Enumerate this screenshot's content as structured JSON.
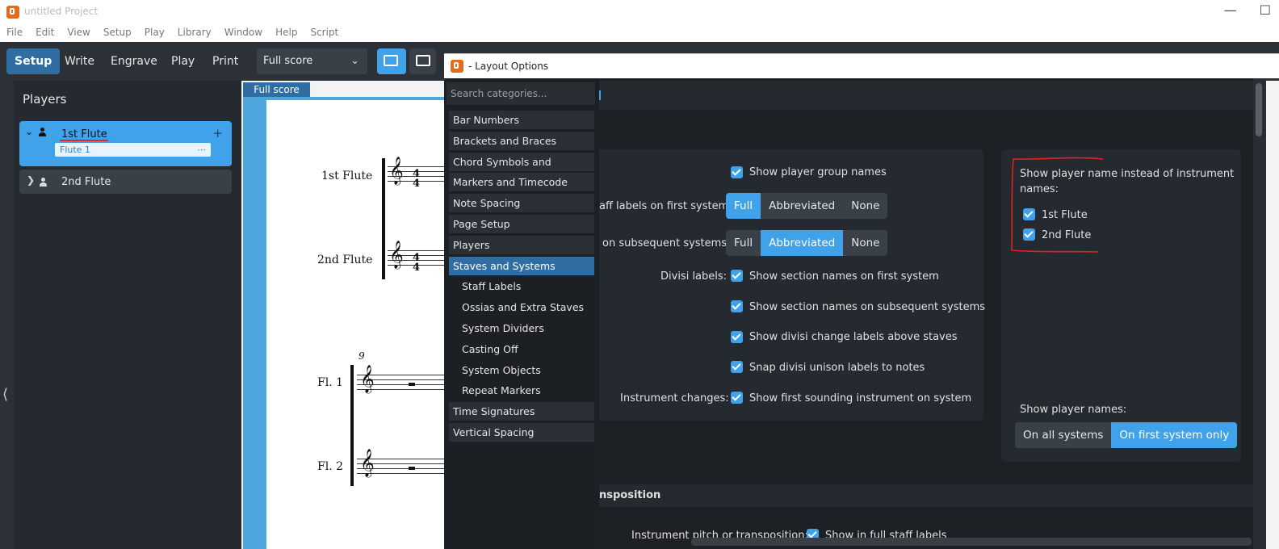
{
  "window": {
    "title": "untitled Project"
  },
  "menubar": [
    "File",
    "Edit",
    "View",
    "Setup",
    "Play",
    "Library",
    "Window",
    "Help",
    "Script"
  ],
  "toolbar": {
    "modes": [
      "Setup",
      "Write",
      "Engrave",
      "Play",
      "Print"
    ],
    "layout_select": "Full score"
  },
  "players_panel": {
    "title": "Players",
    "players": [
      {
        "name": "1st Flute",
        "instrument": "Flute 1",
        "expanded": true
      },
      {
        "name": "2nd Flute",
        "expanded": false
      }
    ]
  },
  "score": {
    "tab": "Full score",
    "labels_first": [
      "1st Flute",
      "2nd Flute"
    ],
    "labels_subsequent": [
      "Fl. 1",
      "Fl. 2"
    ],
    "bar_number": "9",
    "time_signature": "4/4"
  },
  "dialog": {
    "title": "- Layout Options",
    "search_placeholder": "Search categories...",
    "categories": [
      {
        "label": "Bar Numbers",
        "sub": false,
        "active": false
      },
      {
        "label": "Brackets and Braces",
        "sub": false,
        "active": false
      },
      {
        "label": "Chord Symbols and Diagrams",
        "sub": false,
        "active": false
      },
      {
        "label": "Markers and Timecode",
        "sub": false,
        "active": false
      },
      {
        "label": "Note Spacing",
        "sub": false,
        "active": false
      },
      {
        "label": "Page Setup",
        "sub": false,
        "active": false
      },
      {
        "label": "Players",
        "sub": false,
        "active": false
      },
      {
        "label": "Staves and Systems",
        "sub": false,
        "active": true
      },
      {
        "label": "Staff Labels",
        "sub": true,
        "active": false
      },
      {
        "label": "Ossias and Extra Staves",
        "sub": true,
        "active": false
      },
      {
        "label": "System Dividers",
        "sub": true,
        "active": false
      },
      {
        "label": "Casting Off",
        "sub": true,
        "active": false
      },
      {
        "label": "System Objects",
        "sub": true,
        "active": false
      },
      {
        "label": "Repeat Markers",
        "sub": true,
        "active": false
      },
      {
        "label": "Time Signatures",
        "sub": false,
        "active": false
      },
      {
        "label": "Vertical Spacing",
        "sub": false,
        "active": false
      }
    ],
    "options": {
      "show_player_group_names": "Show player group names",
      "staff_labels_first_label": "aff labels on first system:",
      "staff_labels_first": [
        "Full",
        "Abbreviated",
        "None"
      ],
      "staff_labels_first_selected": "Full",
      "staff_labels_subsequent_label": "on subsequent systems:",
      "staff_labels_subsequent": [
        "Full",
        "Abbreviated",
        "None"
      ],
      "staff_labels_subsequent_selected": "Abbreviated",
      "divisi_label": "Divisi labels:",
      "divisi_first": "Show section names on first system",
      "divisi_subsequent": "Show section names on subsequent systems",
      "divisi_change": "Show divisi change labels above staves",
      "divisi_snap": "Snap divisi unison labels to notes",
      "instrument_changes_label": "Instrument changes:",
      "instrument_changes": "Show first sounding instrument on system",
      "player_name_instead": "Show player name instead of instrument names:",
      "player_name_items": [
        "1st Flute",
        "2nd Flute"
      ],
      "show_player_names_label": "Show player names:",
      "show_player_names": [
        "On all systems",
        "On first system only"
      ],
      "show_player_names_selected": "On first system only",
      "section_heading": "nsposition",
      "transposition_label": "Instrument pitch or transposition:",
      "transposition_option": "Show in full staff labels"
    }
  },
  "colors": {
    "accent": "#3fa2ea",
    "active_dark": "#2f6da3",
    "annotation": "#e22222"
  }
}
